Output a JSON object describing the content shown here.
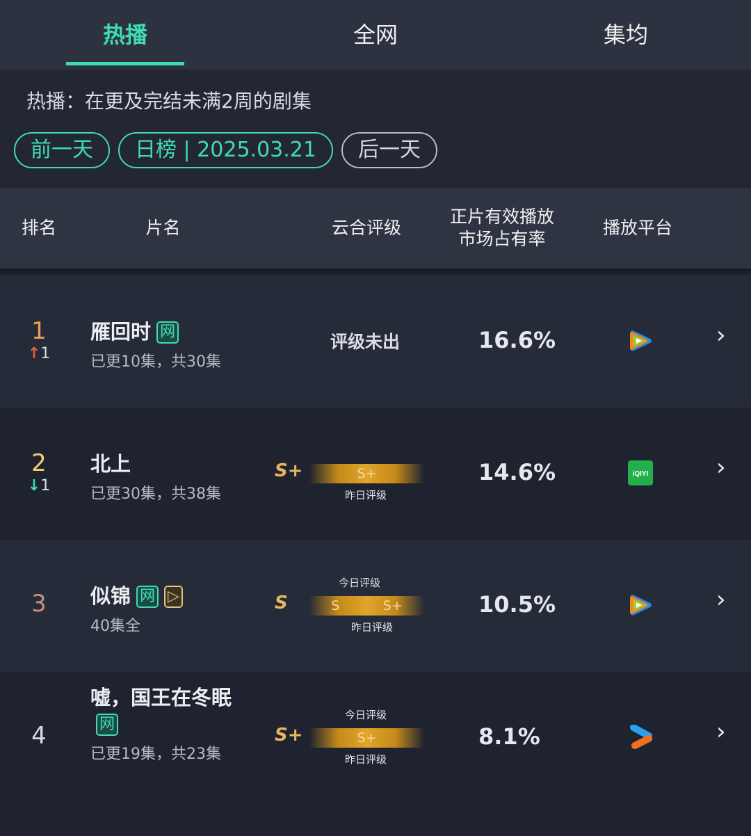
{
  "tabs": [
    {
      "label": "热播",
      "active": true
    },
    {
      "label": "全网"
    },
    {
      "label": "集均"
    }
  ],
  "subtitle": "热播：在更及完结未满2周的剧集",
  "nav": {
    "prev": "前一天",
    "current": "日榜 | 2025.03.21",
    "next": "后一天"
  },
  "columns": [
    "排名",
    "片名",
    "云合评级",
    "正片有效播放\n市场占有率",
    "播放平台"
  ],
  "colors": {
    "accent": "#3fdcb4",
    "up": "#e5603f",
    "down": "#3fdcb4",
    "gold": "#e8b560"
  },
  "labels": {
    "today": "今日评级",
    "yesterday": "昨日评级"
  },
  "rows": [
    {
      "rank": "1",
      "rank_color": "#f0a050",
      "change": "1",
      "dir": "up",
      "title": "雁回时",
      "badges": [
        "网"
      ],
      "episodes": "已更10集，共30集",
      "rating_text": "评级未出",
      "share": "16.6%",
      "platform": "tencent-video-icon"
    },
    {
      "rank": "2",
      "rank_color": "#f0d070",
      "change": "1",
      "dir": "down",
      "title": "北上",
      "badges": [],
      "episodes": "已更30集，共38集",
      "grade": "S+",
      "bar": [
        "S+"
      ],
      "show_today": false,
      "share": "14.6%",
      "platform": "iqiyi-icon",
      "platform_text": "iQIYI"
    },
    {
      "rank": "3",
      "rank_color": "#c8917a",
      "title": "似锦",
      "badges": [
        "网",
        "▷"
      ],
      "episodes": "40集全",
      "grade": "S",
      "bar": [
        "S",
        "S+"
      ],
      "show_today": true,
      "share": "10.5%",
      "platform": "tencent-video-icon"
    },
    {
      "rank": "4",
      "rank_color": "#d8dae0",
      "title": "嘘，国王在冬眠",
      "badges": [
        "网"
      ],
      "episodes": "已更19集，共23集",
      "grade": "S+",
      "bar": [
        "S+"
      ],
      "show_today": true,
      "share": "8.1%",
      "platform": "youku-icon"
    }
  ]
}
